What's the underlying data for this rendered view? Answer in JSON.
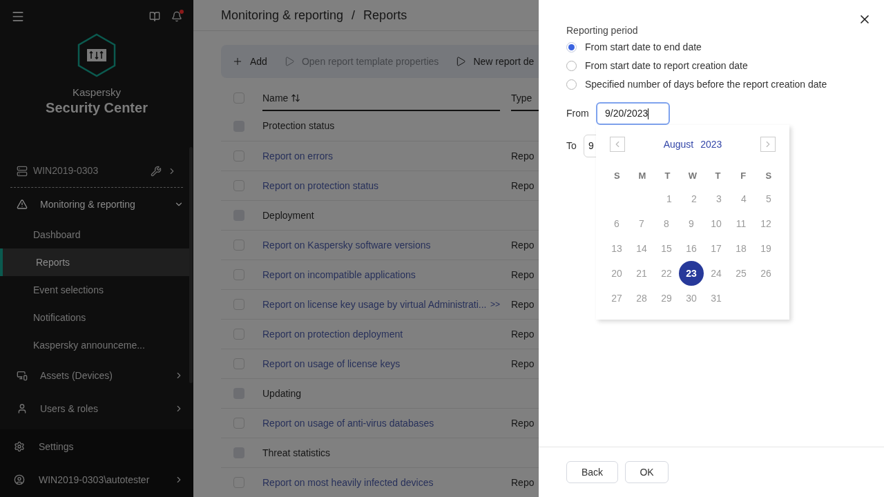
{
  "sidebar": {
    "product_line1": "Kaspersky",
    "product_line2": "Security Center",
    "server": {
      "label": "WIN2019-0303"
    },
    "items": [
      {
        "label": "Monitoring & reporting",
        "kind": "section",
        "expanded": true,
        "children": [
          {
            "label": "Dashboard",
            "selected": false
          },
          {
            "label": "Reports",
            "selected": true
          },
          {
            "label": "Event selections",
            "selected": false
          },
          {
            "label": "Notifications",
            "selected": false
          },
          {
            "label": "Kaspersky announceme...",
            "selected": false
          }
        ]
      },
      {
        "label": "Assets (Devices)",
        "kind": "devices",
        "expanded": false
      },
      {
        "label": "Users & roles",
        "kind": "users",
        "expanded": false
      }
    ],
    "footer": [
      {
        "label": "Settings",
        "kind": "settings"
      },
      {
        "label": "WIN2019-0303\\autotester",
        "kind": "user"
      }
    ]
  },
  "breadcrumb": {
    "items": [
      "Monitoring & reporting",
      "Reports"
    ],
    "separator": "/"
  },
  "toolbar": [
    {
      "label": "Add",
      "kind": "add",
      "disabled": false
    },
    {
      "label": "Open report template properties",
      "kind": "run",
      "disabled": true
    },
    {
      "label": "New report de",
      "kind": "run",
      "disabled": false
    }
  ],
  "table": {
    "columns": [
      "Name",
      "Type"
    ],
    "select_all_checked": false,
    "rows": [
      {
        "kind": "group",
        "name": "Protection status",
        "checked": false
      },
      {
        "kind": "report",
        "name": "Report on errors",
        "type": "Repo",
        "checked": false
      },
      {
        "kind": "report",
        "name": "Report on protection status",
        "type": "Repo",
        "checked": false
      },
      {
        "kind": "group",
        "name": "Deployment",
        "checked": false
      },
      {
        "kind": "report",
        "name": "Report on Kaspersky software versions",
        "type": "Repo",
        "checked": false
      },
      {
        "kind": "report",
        "name": "Report on incompatible applications",
        "type": "Repo",
        "checked": false
      },
      {
        "kind": "report",
        "name": "Report on license key usage by virtual Administrati...",
        "more": ">>",
        "type": "Repo",
        "checked": false
      },
      {
        "kind": "report",
        "name": "Report on protection deployment",
        "type": "Repo",
        "checked": false
      },
      {
        "kind": "report",
        "name": "Report on usage of license keys",
        "type": "Repo",
        "checked": false
      },
      {
        "kind": "group",
        "name": "Updating",
        "checked": false
      },
      {
        "kind": "report",
        "name": "Report on usage of anti-virus databases",
        "type": "Repo",
        "checked": false
      },
      {
        "kind": "group",
        "name": "Threat statistics",
        "checked": false
      },
      {
        "kind": "report",
        "name": "Report on most heavily infected devices",
        "type": "Repo",
        "checked": false
      }
    ]
  },
  "panel": {
    "section_title": "Reporting period",
    "options": [
      {
        "label": "From start date to end date",
        "selected": true
      },
      {
        "label": "From start date to report creation date",
        "selected": false
      },
      {
        "label": "Specified number of days before the report creation date",
        "selected": false
      }
    ],
    "from": {
      "label": "From",
      "value": "9/20/2023"
    },
    "to": {
      "label": "To",
      "value": "9"
    },
    "calendar": {
      "month": "August",
      "year": "2023",
      "weekdays": [
        "S",
        "M",
        "T",
        "W",
        "T",
        "F",
        "S"
      ],
      "weeks": [
        [
          {
            "day": "1",
            "selected": false
          },
          {
            "day": "2",
            "selected": false
          },
          {
            "day": "3",
            "selected": false
          },
          {
            "day": "4",
            "selected": false
          },
          {
            "day": "5",
            "selected": false
          }
        ],
        [
          {
            "day": "6",
            "selected": false
          },
          {
            "day": "7",
            "selected": false
          },
          {
            "day": "8",
            "selected": false
          },
          {
            "day": "9",
            "selected": false
          },
          {
            "day": "10",
            "selected": false
          },
          {
            "day": "11",
            "selected": false
          },
          {
            "day": "12",
            "selected": false
          }
        ],
        [
          {
            "day": "13",
            "selected": false
          },
          {
            "day": "14",
            "selected": false
          },
          {
            "day": "15",
            "selected": false
          },
          {
            "day": "16",
            "selected": false
          },
          {
            "day": "17",
            "selected": false
          },
          {
            "day": "18",
            "selected": false
          },
          {
            "day": "19",
            "selected": false
          }
        ],
        [
          {
            "day": "20",
            "selected": false
          },
          {
            "day": "21",
            "selected": false
          },
          {
            "day": "22",
            "selected": false
          },
          {
            "day": "23",
            "selected": true
          },
          {
            "day": "24",
            "selected": false
          },
          {
            "day": "25",
            "selected": false
          },
          {
            "day": "26",
            "selected": false
          }
        ],
        [
          {
            "day": "27",
            "selected": false
          },
          {
            "day": "28",
            "selected": false
          },
          {
            "day": "29",
            "selected": false
          },
          {
            "day": "30",
            "selected": false
          },
          {
            "day": "31",
            "selected": false
          }
        ]
      ]
    },
    "buttons": [
      "Back",
      "OK"
    ]
  }
}
